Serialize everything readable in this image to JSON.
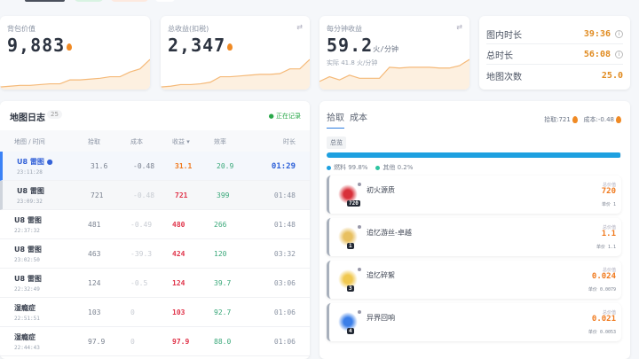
{
  "stats": [
    {
      "label": "背包价值",
      "value": "9,883",
      "series": [
        1,
        2,
        3,
        3,
        4,
        5,
        5,
        10,
        10,
        11,
        12,
        14,
        14,
        20,
        24,
        36
      ]
    },
    {
      "label": "总收益(扣税)",
      "value": "2,347",
      "series": [
        1,
        2,
        4,
        4,
        5,
        7,
        14,
        14,
        15,
        16,
        17,
        17,
        18,
        24,
        24,
        36
      ]
    },
    {
      "label": "每分钟收益",
      "value": "59.2",
      "unit": "火/分钟",
      "sub": "实际 41.8 火/分钟",
      "series": [
        8,
        14,
        10,
        16,
        12,
        12,
        12,
        26,
        25,
        26,
        26,
        26,
        25,
        25,
        28,
        36
      ]
    }
  ],
  "summary": [
    {
      "label": "图内时长",
      "value": "39:36",
      "info": true
    },
    {
      "label": "总时长",
      "value": "56:08",
      "info": true
    },
    {
      "label": "地图次数",
      "value": "25.0",
      "info": false
    }
  ],
  "log": {
    "title": "地图日志",
    "count": "25",
    "status": "● 正在记录",
    "headers": [
      "地图 / 时间",
      "拾取",
      "成本",
      "收益 ▾",
      "效率",
      "时长"
    ],
    "rows": [
      {
        "map": "U8 雷图 ●",
        "time": "23:11:28",
        "pickup": "31.6",
        "cost": "-0.48",
        "profit": "31.1",
        "eff": "20.9",
        "dur": "01:29"
      },
      {
        "map": "U8 雷图",
        "time": "23:09:32",
        "pickup": "721",
        "cost": "-0.48",
        "profit": "721",
        "eff": "399",
        "dur": "01:48"
      },
      {
        "map": "U8 雷图",
        "time": "22:37:32",
        "pickup": "481",
        "cost": "-0.49",
        "profit": "480",
        "eff": "266",
        "dur": "01:48"
      },
      {
        "map": "U8 雷图",
        "time": "23:02:50",
        "pickup": "463",
        "cost": "-39.3",
        "profit": "424",
        "eff": "120",
        "dur": "03:32"
      },
      {
        "map": "U8 雷图",
        "time": "22:32:49",
        "pickup": "124",
        "cost": "-0.5",
        "profit": "124",
        "eff": "39.7",
        "dur": "03:06"
      },
      {
        "map": "湿瘾症",
        "time": "22:51:51",
        "pickup": "103",
        "cost": "0",
        "profit": "103",
        "eff": "92.7",
        "dur": "01:06"
      },
      {
        "map": "湿瘾症",
        "time": "22:44:43",
        "pickup": "97.9",
        "cost": "0",
        "profit": "97.9",
        "eff": "88.0",
        "dur": "01:06"
      }
    ]
  },
  "detail": {
    "tabs": [
      "拾取",
      "成本"
    ],
    "pickup_total": "拾取:721",
    "cost_total": "成本:-0.48",
    "chip": "总览",
    "bar_fraction": 0.998,
    "legend": [
      {
        "label": "燃料 99.8%",
        "color": "#1ea0e0"
      },
      {
        "label": "其他 0.2%",
        "color": "#2ec4a0"
      }
    ],
    "total_label": "总价值",
    "unit_label": "单价",
    "items": [
      {
        "name": "初火源质",
        "qty": "720",
        "total": "720",
        "unit": "1",
        "color": "#d8303a"
      },
      {
        "name": "追忆游丝-卓越",
        "qty": "1",
        "total": "1.1",
        "unit": "1.1",
        "color": "#e8c060"
      },
      {
        "name": "追忆碎絮",
        "qty": "3",
        "total": "0.024",
        "unit": "0.0079",
        "color": "#f0c850"
      },
      {
        "name": "异界回响",
        "qty": "4",
        "total": "0.021",
        "unit": "0.0053",
        "color": "#3a7ee8"
      }
    ]
  }
}
